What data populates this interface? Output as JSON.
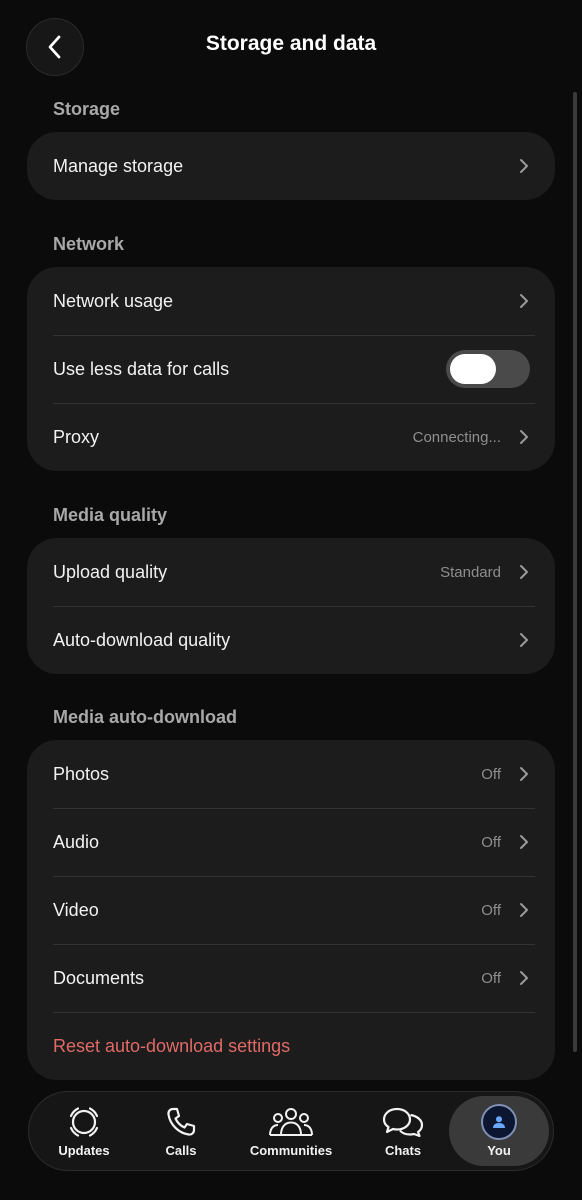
{
  "header": {
    "title": "Storage and data"
  },
  "sections": {
    "storage": {
      "label": "Storage",
      "rows": {
        "manage": "Manage storage"
      }
    },
    "network": {
      "label": "Network",
      "rows": {
        "usage": "Network usage",
        "less_data": "Use less data for calls",
        "proxy": "Proxy",
        "proxy_value": "Connecting..."
      }
    },
    "media_quality": {
      "label": "Media quality",
      "rows": {
        "upload": "Upload quality",
        "upload_value": "Standard",
        "auto_download": "Auto-download quality"
      }
    },
    "auto_download": {
      "label": "Media auto-download",
      "rows": {
        "photos": "Photos",
        "photos_value": "Off",
        "audio": "Audio",
        "audio_value": "Off",
        "video": "Video",
        "video_value": "Off",
        "documents": "Documents",
        "documents_value": "Off",
        "reset": "Reset auto-download settings"
      }
    }
  },
  "toggle_state": {
    "use_less_data_for_calls": false
  },
  "tabs": {
    "updates": "Updates",
    "calls": "Calls",
    "communities": "Communities",
    "chats": "Chats",
    "you": "You"
  },
  "active_tab": "You",
  "colors": {
    "accent_danger": "#e06a66",
    "card": "#1c1c1c",
    "background": "#0b0b0b"
  },
  "icons": [
    "chevron-left-icon",
    "chevron-right-icon",
    "updates-icon",
    "phone-icon",
    "communities-icon",
    "chats-icon",
    "person-icon"
  ]
}
